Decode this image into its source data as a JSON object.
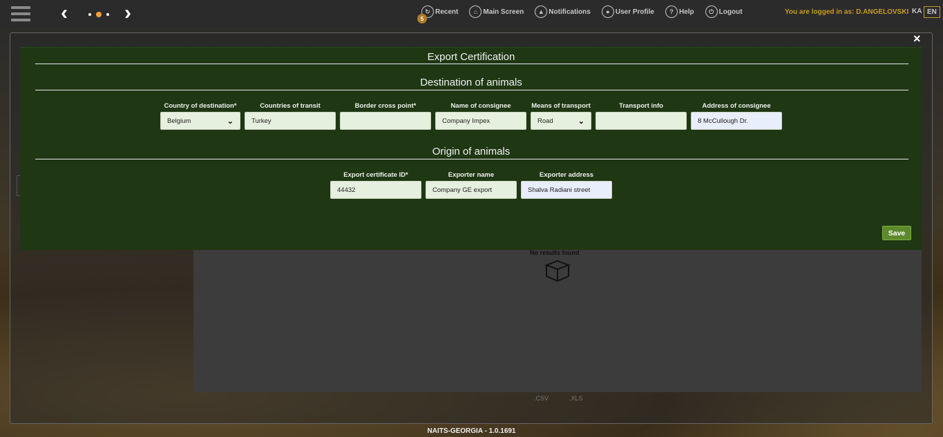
{
  "topbar": {
    "menu": [
      {
        "label": "Recent",
        "icon": "recent-icon"
      },
      {
        "label": "Main Screen",
        "icon": "home-icon"
      },
      {
        "label": "Notifications",
        "icon": "bell-icon"
      },
      {
        "label": "User Profile",
        "icon": "user-icon"
      },
      {
        "label": "Help",
        "icon": "help-icon"
      },
      {
        "label": "Logout",
        "icon": "power-icon"
      }
    ],
    "recent_badge": "5",
    "logged_in_text": "You are logged in as: D.ANGELOVSKI",
    "lang_ka": "KA",
    "lang_en": "EN"
  },
  "background": {
    "no_results": "No results found",
    "export_csv": ".CSV",
    "export_xls": ".XLS"
  },
  "modal": {
    "close_label": "×",
    "title": "Export Certification",
    "destination": {
      "title": "Destination of animals",
      "fields": {
        "country": {
          "label": "Country of destination*",
          "value": "Belgium"
        },
        "transit": {
          "label": "Countries of transit",
          "value": "Turkey"
        },
        "border": {
          "label": "Border cross point*",
          "value": ""
        },
        "consignee": {
          "label": "Name of consignee",
          "value": "Company Impex"
        },
        "transport": {
          "label": "Means of transport",
          "value": "Road"
        },
        "transport_info": {
          "label": "Transport info",
          "value": ""
        },
        "address": {
          "label": "Address of consignee",
          "value": "8 McCullough Dr."
        }
      }
    },
    "origin": {
      "title": "Origin of animals",
      "fields": {
        "cert_id": {
          "label": "Export certificate ID*",
          "value": "44432"
        },
        "exporter_name": {
          "label": "Exporter name",
          "value": "Company GE export"
        },
        "exporter_address": {
          "label": "Exporter address",
          "value": "Shalva Radiani street"
        }
      }
    },
    "save_label": "Save"
  },
  "footer": "NAITS-GEORGIA - 1.0.1691",
  "colors": {
    "modal_bg": "#1f3713",
    "accent_gold": "#c89a28",
    "save_green": "#5d8a2a"
  }
}
